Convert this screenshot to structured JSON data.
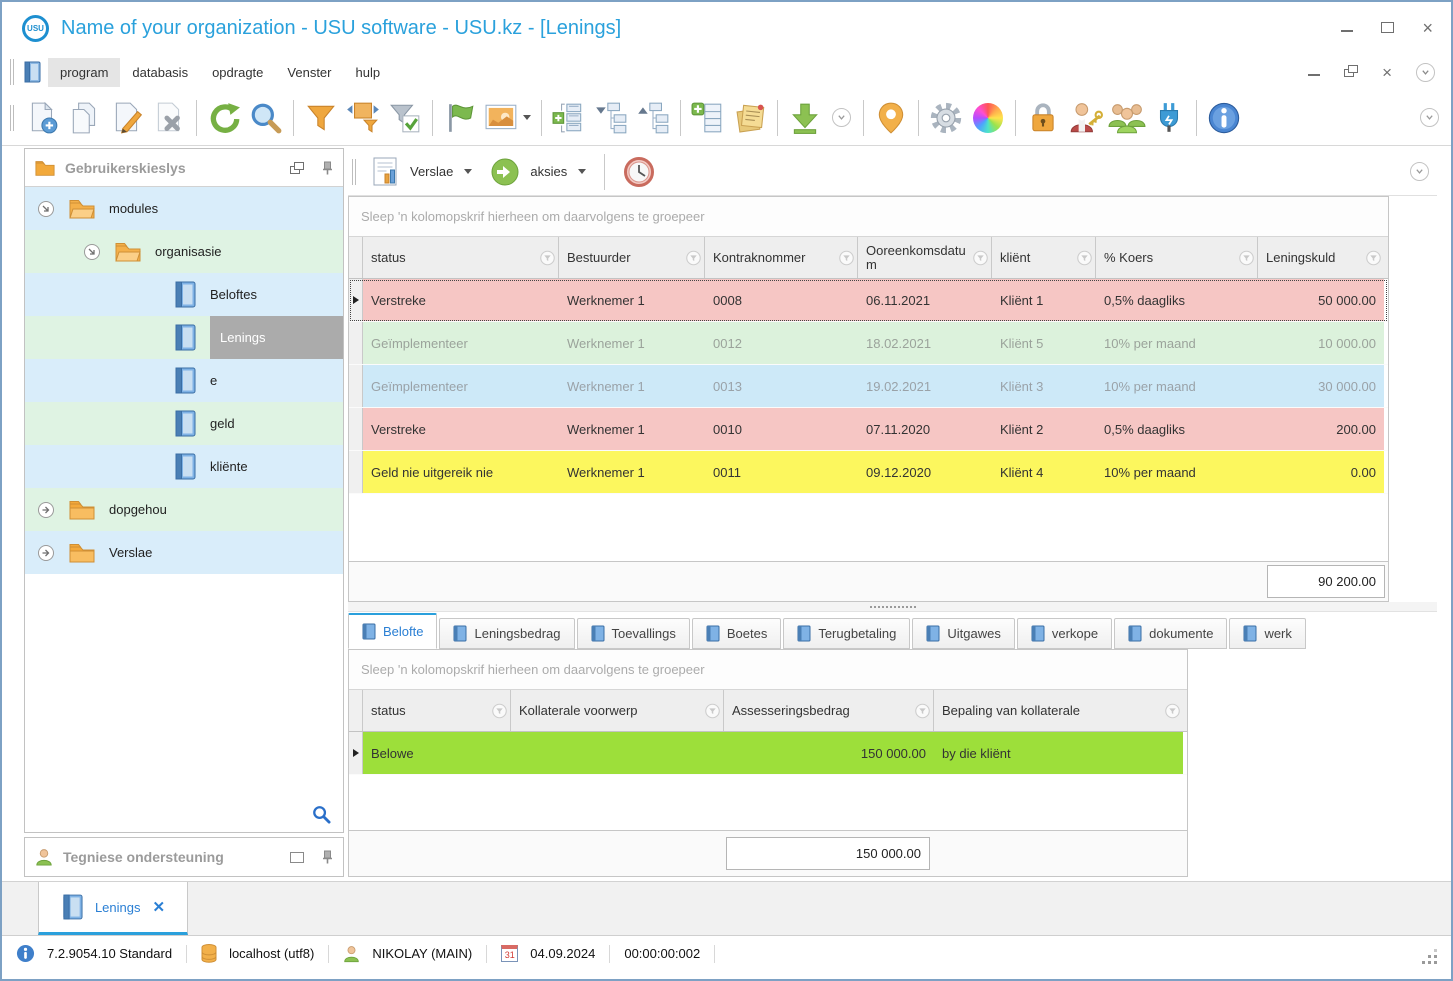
{
  "window": {
    "title": "Name of your organization - USU software - USU.kz - [Lenings]",
    "logo_text": "USU"
  },
  "menu": {
    "items": [
      "program",
      "databasis",
      "opdragte",
      "Venster",
      "hulp"
    ]
  },
  "toolbar": {
    "icons": [
      "new-document",
      "copy-document",
      "edit-document",
      "delete-document",
      "refresh",
      "search",
      "filter",
      "filter-by-range",
      "filter-apply",
      "flag",
      "image-picker",
      "expand-rows",
      "tree-collapse",
      "tree-expand",
      "add-column",
      "notes",
      "export",
      "overflow-chevron",
      "location-pin",
      "settings-gear",
      "color-scheme",
      "lock",
      "user-permissions",
      "user-groups",
      "plugin",
      "info"
    ]
  },
  "content_toolbar": {
    "verslae_label": "Verslae",
    "aksies_label": "aksies"
  },
  "sidebar": {
    "header": "Gebruikerskieslys",
    "items": [
      {
        "label": "modules"
      },
      {
        "label": "organisasie"
      },
      {
        "label": "Beloftes"
      },
      {
        "label": "Lenings",
        "selected": true
      },
      {
        "label": "e"
      },
      {
        "label": "geld"
      },
      {
        "label": "kliënte"
      },
      {
        "label": "dopgehou"
      },
      {
        "label": "Verslae"
      }
    ],
    "support_header": "Tegniese ondersteuning"
  },
  "loans_grid": {
    "group_hint": "Sleep 'n kolomopskrif hierheen om daarvolgens te groepeer",
    "columns": [
      "status",
      "Bestuurder",
      "Kontraknommer",
      "Ooreenkomsdatum",
      "kliënt",
      "% Koers",
      "Leningskuld"
    ],
    "rows": [
      {
        "status": "Verstreke",
        "bestuurder": "Werknemer 1",
        "kontraknommer": "0008",
        "datum": "06.11.2021",
        "klient": "Kliënt 1",
        "koers": "0,5% daagliks",
        "skuld": "50 000.00",
        "highlight": "pink",
        "selected": true
      },
      {
        "status": "Geïmplementeer",
        "bestuurder": "Werknemer 1",
        "kontraknommer": "0012",
        "datum": "18.02.2021",
        "klient": "Kliënt 5",
        "koers": "10% per maand",
        "skuld": "10 000.00",
        "highlight": "green"
      },
      {
        "status": "Geïmplementeer",
        "bestuurder": "Werknemer 1",
        "kontraknommer": "0013",
        "datum": "19.02.2021",
        "klient": "Kliënt 3",
        "koers": "10% per maand",
        "skuld": "30 000.00",
        "highlight": "blue"
      },
      {
        "status": "Verstreke",
        "bestuurder": "Werknemer 1",
        "kontraknommer": "0010",
        "datum": "07.11.2020",
        "klient": "Kliënt 2",
        "koers": "0,5% daagliks",
        "skuld": "200.00",
        "highlight": "pink"
      },
      {
        "status": "Geld nie uitgereik nie",
        "bestuurder": "Werknemer 1",
        "kontraknommer": "0011",
        "datum": "09.12.2020",
        "klient": "Kliënt 4",
        "koers": "10% per maand",
        "skuld": "0.00",
        "highlight": "yellow"
      }
    ],
    "total": "90 200.00"
  },
  "detail_tabs": [
    {
      "label": "Belofte",
      "active": true
    },
    {
      "label": "Leningsbedrag"
    },
    {
      "label": "Toevallings"
    },
    {
      "label": "Boetes"
    },
    {
      "label": "Terugbetaling"
    },
    {
      "label": "Uitgawes"
    },
    {
      "label": "verkope"
    },
    {
      "label": "dokumente"
    },
    {
      "label": "werk"
    }
  ],
  "collateral_grid": {
    "group_hint": "Sleep 'n kolomopskrif hierheen om daarvolgens te groepeer",
    "columns": [
      "status",
      "Kollaterale voorwerp",
      "Assesseringsbedrag",
      "Bepaling van kollaterale"
    ],
    "rows": [
      {
        "status": "Belowe",
        "voorwerp": "",
        "bedrag": "150 000.00",
        "bepaling": "by die kliënt",
        "highlight": "limegreen",
        "selected": true
      }
    ],
    "total": "150 000.00"
  },
  "doc_tab": {
    "label": "Lenings"
  },
  "status_bar": {
    "version": "7.2.9054.10 Standard",
    "database": "localhost (utf8)",
    "user": "NIKOLAY (MAIN)",
    "calendar_day": "31",
    "date": "04.09.2024",
    "time": "00:00:00:002"
  },
  "colors": {
    "accent_blue": "#2aa1dc",
    "row_overdue_pink": "#f6c6c4",
    "row_implemented_green": "#dcf2dc",
    "row_implemented_blue": "#cde9f8",
    "row_not_issued_yellow": "#fcf75e",
    "row_collateral_green": "#9ddf3a",
    "sidebar_row_blue": "#d9edfa",
    "sidebar_row_green": "#dff3e3",
    "selected_node_gray": "#ababab"
  }
}
